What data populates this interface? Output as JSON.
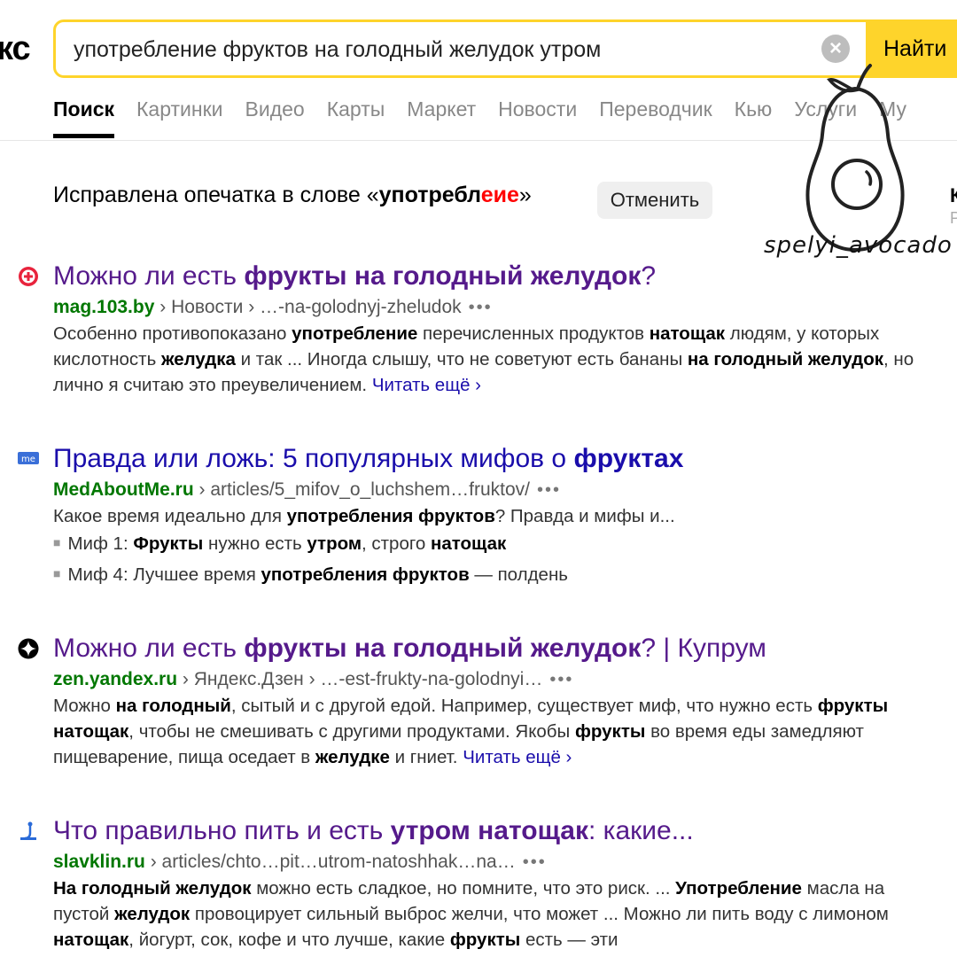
{
  "logo_fragment": "кс",
  "search": {
    "query": "употребление фруктов на голодный желудок утром",
    "clear_icon": "×",
    "button_label": "Найти"
  },
  "tabs": [
    "Поиск",
    "Картинки",
    "Видео",
    "Карты",
    "Маркет",
    "Новости",
    "Переводчик",
    "Кью",
    "Услуги",
    "Му"
  ],
  "correction": {
    "text_before": "Исправлена опечатка в слове «",
    "word_part1": "употреб",
    "word_part2": "л",
    "word_part3": "е",
    "word_part4": "ие",
    "text_after": "»",
    "cancel_label": "Отменить"
  },
  "side_cutoff": {
    "letter1": "К",
    "letter2": "Р"
  },
  "results": [
    {
      "title_pre": "Можно ли есть ",
      "title_bold": "фрукты на голодный желудок",
      "title_post": "?",
      "domain": "mag.103.by",
      "path": " › Новости › …-na-golodnyj-zheludok",
      "dots": "•••",
      "snippet": [
        {
          "t": "Особенно противопоказано ",
          "b": false
        },
        {
          "t": "употребление",
          "b": true
        },
        {
          "t": " перечисленных продуктов ",
          "b": false
        },
        {
          "t": "натощак",
          "b": true
        },
        {
          "t": " людям, у которых кислотность ",
          "b": false
        },
        {
          "t": "желудка",
          "b": true
        },
        {
          "t": " и так ... Иногда слышу, что не советуют есть бананы ",
          "b": false
        },
        {
          "t": "на голодный желудок",
          "b": true
        },
        {
          "t": ", но лично я считаю это преувеличением. ",
          "b": false
        }
      ],
      "read_more": "Читать ещё ›"
    },
    {
      "title_pre": "Правда или ложь: 5 популярных мифов о ",
      "title_bold": "фруктах",
      "title_post": "",
      "domain": "MedAboutMe.ru",
      "path": " › articles/5_mifov_o_luchshem…fruktov/",
      "dots": "•••",
      "snippet": [
        {
          "t": "Какое время идеально для ",
          "b": false
        },
        {
          "t": "употребления фруктов",
          "b": true
        },
        {
          "t": "? Правда и мифы и...",
          "b": false
        }
      ],
      "bullets": [
        [
          {
            "t": "Миф 1: ",
            "b": false
          },
          {
            "t": "Фрукты",
            "b": true
          },
          {
            "t": " нужно есть ",
            "b": false
          },
          {
            "t": "утром",
            "b": true
          },
          {
            "t": ", строго ",
            "b": false
          },
          {
            "t": "натощак",
            "b": true
          }
        ],
        [
          {
            "t": "Миф 4: Лучшее время ",
            "b": false
          },
          {
            "t": "употребления фруктов",
            "b": true
          },
          {
            "t": " — полдень",
            "b": false
          }
        ]
      ]
    },
    {
      "title_pre": "Можно ли есть ",
      "title_bold": "фрукты на голодный желудок",
      "title_post": "? | Купрум",
      "domain": "zen.yandex.ru",
      "path": " › Яндекс.Дзен › …-est-frukty-na-golodnyi…",
      "dots": "•••",
      "snippet": [
        {
          "t": "Можно ",
          "b": false
        },
        {
          "t": "на голодный",
          "b": true
        },
        {
          "t": ", сытый и с другой едой. Например, существует миф, что нужно есть ",
          "b": false
        },
        {
          "t": "фрукты натощак",
          "b": true
        },
        {
          "t": ", чтобы не смешивать с другими продуктами. Якобы ",
          "b": false
        },
        {
          "t": "фрукты",
          "b": true
        },
        {
          "t": " во время еды замедляют пищеварение, пища оседает в ",
          "b": false
        },
        {
          "t": "желудке",
          "b": true
        },
        {
          "t": " и гниет. ",
          "b": false
        }
      ],
      "read_more": "Читать ещё ›"
    },
    {
      "title_pre": "Что правильно пить и есть ",
      "title_bold": "утром натощак",
      "title_post": ": какие...",
      "domain": "slavklin.ru",
      "path": " › articles/chto…pit…utrom-natoshhak…na…",
      "dots": "•••",
      "snippet": [
        {
          "t": "На голодный желудок",
          "b": true
        },
        {
          "t": " можно есть сладкое, но помните, что это риск. ... ",
          "b": false
        },
        {
          "t": "Употребление",
          "b": true
        },
        {
          "t": " масла на пустой ",
          "b": false
        },
        {
          "t": "желудок",
          "b": true
        },
        {
          "t": " провоцирует сильный выброс желчи, что может ... Можно ли пить воду с лимоном ",
          "b": false
        },
        {
          "t": "натощак",
          "b": true
        },
        {
          "t": ", йогурт, сок, кофе и что лучше, какие ",
          "b": false
        },
        {
          "t": "фрукты",
          "b": true
        },
        {
          "t": " есть — эти",
          "b": false
        }
      ]
    }
  ],
  "watermark": {
    "text": "spelyi_avocado",
    "icon": "avocado-icon"
  }
}
